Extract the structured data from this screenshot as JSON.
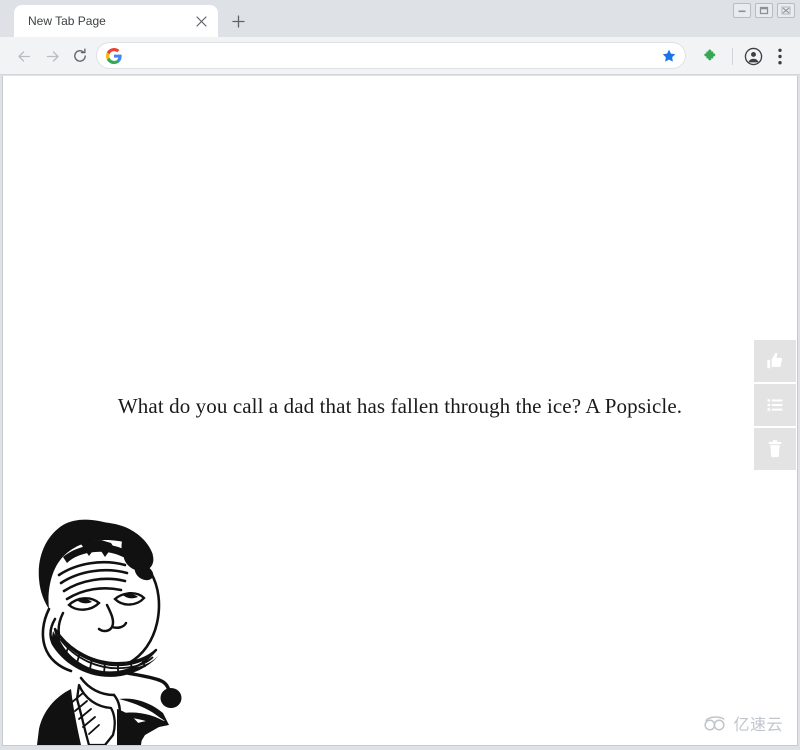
{
  "window": {
    "controls": [
      {
        "name": "minimize",
        "label": "Minimize"
      },
      {
        "name": "maximize",
        "label": "Restore"
      },
      {
        "name": "close",
        "label": "Close"
      }
    ]
  },
  "tabstrip": {
    "tab_title": "New Tab Page",
    "close_tab_label": "Close tab",
    "new_tab_label": "New tab"
  },
  "toolbar": {
    "back_label": "Back",
    "forward_label": "Forward",
    "reload_label": "Reload",
    "omnibox_value": "",
    "omnibox_placeholder": "",
    "search_engine_icon": "google-g-icon",
    "bookmark_label": "Bookmark this tab",
    "bookmark_state": "bookmarked",
    "extensions_label": "Extensions",
    "profile_label": "Profile",
    "menu_label": "Customize and control"
  },
  "page": {
    "joke": "What do you call a dad that has fallen through the ice? A Popsicle.",
    "image_alt": "troll-face-meme"
  },
  "action_rail": [
    {
      "name": "like-button",
      "icon": "thumbs-up-icon",
      "label": "Like"
    },
    {
      "name": "list-button",
      "icon": "list-icon",
      "label": "List"
    },
    {
      "name": "delete-button",
      "icon": "trash-icon",
      "label": "Delete"
    }
  ],
  "watermark": {
    "text": "亿速云",
    "icon": "cloud-logo-icon"
  },
  "colors": {
    "tabstrip_bg": "#dee1e6",
    "toolbar_bg": "#f1f3f4",
    "page_bg": "#ffffff",
    "bookmark_star": "#1a73e8",
    "extension_green": "#34a853",
    "action_button_bg": "#e3e3e3",
    "text": "#1a1a1a"
  }
}
